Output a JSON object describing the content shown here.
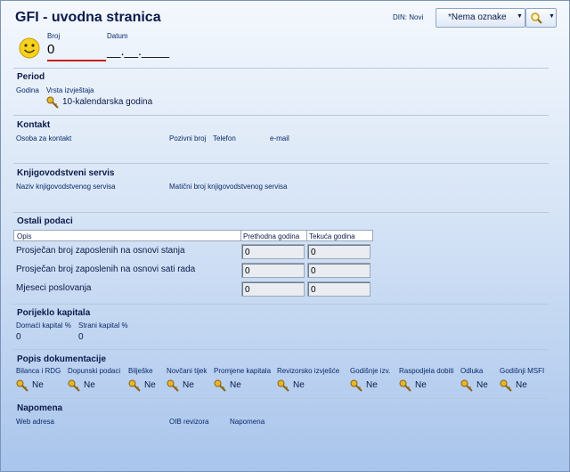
{
  "header": {
    "title": "GFI - uvodna stranica",
    "din_label": "DIN: Novi",
    "tag_select": "*Nema oznake"
  },
  "top": {
    "broj_label": "Broj",
    "broj_value": "0",
    "datum_label": "Datum",
    "datum_value": "__.__.____"
  },
  "period": {
    "title": "Period",
    "godina_label": "Godina",
    "vrsta_label": "Vrsta izvještaja",
    "vrsta_value": "10-kalendarska godina"
  },
  "kontakt": {
    "title": "Kontakt",
    "osoba_label": "Osoba za kontakt",
    "pozivni_label": "Pozivni broj",
    "telefon_label": "Telefon",
    "email_label": "e-mail"
  },
  "knjigovodstveni": {
    "title": "Knjigovodstveni servis",
    "naziv_label": "Naziv knjigovodstvenog servisa",
    "maticni_label": "Matični broj knjigovodstvenog servisa"
  },
  "ostali": {
    "title": "Ostali podaci",
    "headers": [
      "Opis",
      "Prethodna godina",
      "Tekuća godina"
    ],
    "rows": [
      {
        "label": "Prosječan broj zaposlenih na osnovi stanja",
        "prev": "0",
        "curr": "0"
      },
      {
        "label": "Prosječan broj zaposlenih na osnovi sati rada",
        "prev": "0",
        "curr": "0"
      },
      {
        "label": "Mjeseci poslovanja",
        "prev": "0",
        "curr": "0"
      }
    ]
  },
  "porijeklo": {
    "title": "Porijeklo kapitala",
    "domaci_label": "Domaći kapital %",
    "domaci_value": "0",
    "strani_label": "Strani kapital %",
    "strani_value": "0"
  },
  "popis": {
    "title": "Popis dokumentacije",
    "items": [
      {
        "label": "Bilanca i RDG",
        "value": "Ne"
      },
      {
        "label": "Dopunski podaci",
        "value": "Ne"
      },
      {
        "label": "Bilješke",
        "value": "Ne"
      },
      {
        "label": "Novčani tijek",
        "value": "Ne"
      },
      {
        "label": "Promjene kapitala",
        "value": "Ne"
      },
      {
        "label": "Revizorsko izvješće",
        "value": "Ne"
      },
      {
        "label": "Godišnje izv.",
        "value": "Ne"
      },
      {
        "label": "Raspodjela dobiti",
        "value": "Ne"
      },
      {
        "label": "Odluka",
        "value": "Ne"
      },
      {
        "label": "Godišnji MSFI",
        "value": "Ne"
      }
    ]
  },
  "napomena": {
    "title": "Napomena",
    "web_label": "Web adresa",
    "oib_label": "OIB revizora",
    "napomena_label": "Napomena"
  },
  "colors": {
    "accent_red": "#c62020",
    "section_text": "#0b1a4a"
  }
}
